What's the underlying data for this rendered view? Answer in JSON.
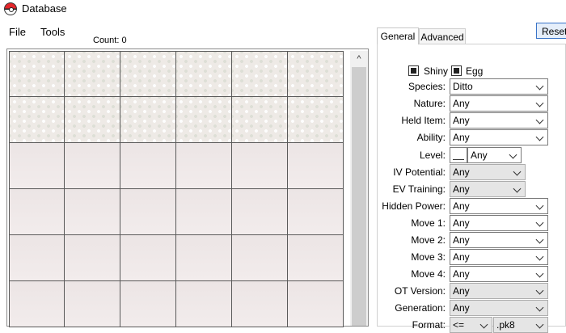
{
  "window": {
    "title": "Database"
  },
  "menu": {
    "file": "File",
    "tools": "Tools"
  },
  "results": {
    "count_label": "Count: 0"
  },
  "scrollbar": {
    "up_arrow": "^"
  },
  "tabs": {
    "general": "General",
    "advanced": "Advanced"
  },
  "reset_label": "Reset",
  "checkboxes": {
    "shiny": "Shiny",
    "egg": "Egg"
  },
  "filters": {
    "species": {
      "label": "Species:",
      "value": "Ditto"
    },
    "nature": {
      "label": "Nature:",
      "value": "Any"
    },
    "held_item": {
      "label": "Held Item:",
      "value": "Any"
    },
    "ability": {
      "label": "Ability:",
      "value": "Any"
    },
    "level": {
      "label": "Level:",
      "value": "Any"
    },
    "iv_potential": {
      "label": "IV Potential:",
      "value": "Any"
    },
    "ev_training": {
      "label": "EV Training:",
      "value": "Any"
    },
    "hidden_power": {
      "label": "Hidden Power:",
      "value": "Any"
    },
    "move1": {
      "label": "Move 1:",
      "value": "Any"
    },
    "move2": {
      "label": "Move 2:",
      "value": "Any"
    },
    "move3": {
      "label": "Move 3:",
      "value": "Any"
    },
    "move4": {
      "label": "Move 4:",
      "value": "Any"
    },
    "ot_version": {
      "label": "OT Version:",
      "value": "Any"
    },
    "generation": {
      "label": "Generation:",
      "value": "Any"
    },
    "format": {
      "label": "Format:",
      "comparator": "<=",
      "value": ".pk8"
    }
  },
  "icons": {
    "app": "pokeball-icon",
    "dropdown": "chevron-down-icon"
  },
  "colors": {
    "accent": "#3a74c8",
    "disabled_field": "#e5e5e5"
  }
}
